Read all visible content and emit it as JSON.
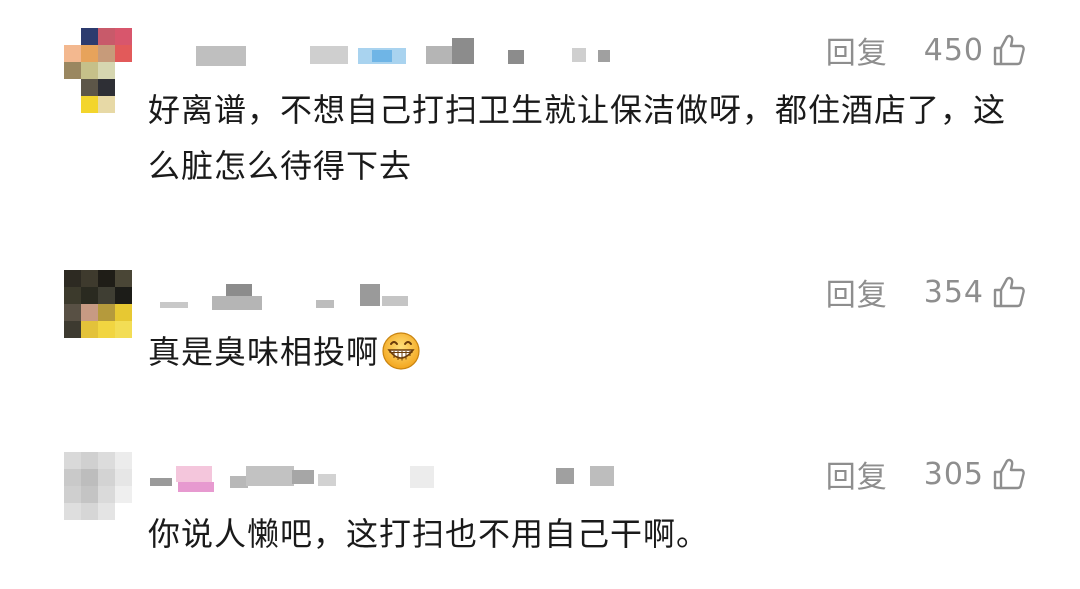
{
  "comments": [
    {
      "reply_label": "回复",
      "likes": "450",
      "text": "好离谱，不想自己打扫卫生就让保洁做呀，都住酒店了，这么脏怎么待得下去"
    },
    {
      "reply_label": "回复",
      "likes": "354",
      "text": "真是臭味相投啊",
      "emoji": "grinning-face"
    },
    {
      "reply_label": "回复",
      "likes": "305",
      "text": "你说人懒吧，这打扫也不用自己干啊。"
    }
  ],
  "icons": {
    "like": "thumbs-up-outline-icon",
    "emoji": "grinning-face-icon"
  },
  "colors": {
    "text": "#1a1a1a",
    "meta": "#8e8e8e",
    "background": "#ffffff"
  }
}
